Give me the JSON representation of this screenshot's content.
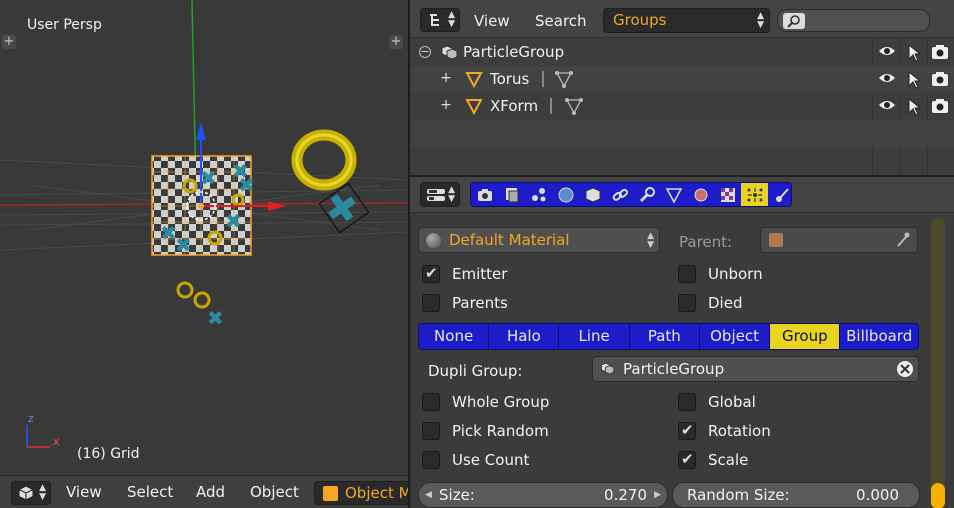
{
  "viewport": {
    "view_name": "User Persp",
    "grid_label": "(16) Grid",
    "axis_x": "x",
    "axis_z": "z"
  },
  "viewport_header": {
    "menus": [
      "View",
      "Select",
      "Add",
      "Object"
    ],
    "mode": "Object M"
  },
  "outliner": {
    "menus": [
      "View",
      "Search"
    ],
    "display_mode": "Groups",
    "search_placeholder": "",
    "rows": [
      {
        "name": "ParticleGroup",
        "expand": "−"
      },
      {
        "name": "Torus",
        "expand": "+"
      },
      {
        "name": "XForm",
        "expand": "+"
      }
    ]
  },
  "properties": {
    "material": "Default Material",
    "parent_label": "Parent:",
    "checks": {
      "emitter": {
        "label": "Emitter",
        "checked": true
      },
      "unborn": {
        "label": "Unborn",
        "checked": false
      },
      "parents": {
        "label": "Parents",
        "checked": false
      },
      "died": {
        "label": "Died",
        "checked": false
      }
    },
    "render_types": [
      "None",
      "Halo",
      "Line",
      "Path",
      "Object",
      "Group",
      "Billboard"
    ],
    "render_active": "Group",
    "dupli_group_label": "Dupli Group:",
    "dupli_group_value": "ParticleGroup",
    "group_checks": {
      "whole_group": {
        "label": "Whole Group",
        "checked": false
      },
      "global": {
        "label": "Global",
        "checked": false
      },
      "pick_random": {
        "label": "Pick Random",
        "checked": false
      },
      "rotation": {
        "label": "Rotation",
        "checked": true
      },
      "use_count": {
        "label": "Use Count",
        "checked": false
      },
      "scale": {
        "label": "Scale",
        "checked": true
      }
    },
    "size_label": "Size:",
    "size_value": "0.270",
    "random_size_label": "Random Size:",
    "random_size_value": "0.000"
  },
  "colors": {
    "accent_orange": "#f5a623",
    "tab_blue": "#1c1cc8",
    "active_yellow": "#e9d422"
  }
}
